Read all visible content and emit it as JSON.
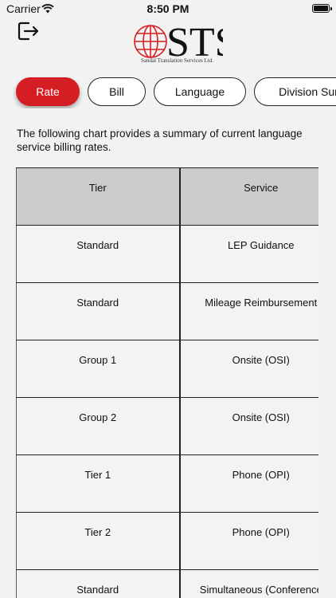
{
  "status": {
    "carrier": "Carrier",
    "time": "8:50 PM"
  },
  "brand": {
    "logo_text": "STS",
    "caption": "Sandal Translation Services Ltd.",
    "accent": "#d51e23"
  },
  "tabs": [
    {
      "label": "Rate",
      "active": true
    },
    {
      "label": "Bill",
      "active": false
    },
    {
      "label": "Language",
      "active": false
    },
    {
      "label": "Division Summary",
      "active": false
    }
  ],
  "intro": "The following chart provides a summary of current language service billing rates.",
  "table": {
    "headers": [
      "Tier",
      "Service"
    ],
    "rows": [
      [
        "Standard",
        "LEP Guidance"
      ],
      [
        "Standard",
        "Mileage Reimbursement"
      ],
      [
        "Group 1",
        "Onsite (OSI)"
      ],
      [
        "Group 2",
        "Onsite (OSI)"
      ],
      [
        "Tier 1",
        "Phone (OPI)"
      ],
      [
        "Tier 2",
        "Phone (OPI)"
      ],
      [
        "Standard",
        "Simultaneous (Conference"
      ]
    ]
  }
}
